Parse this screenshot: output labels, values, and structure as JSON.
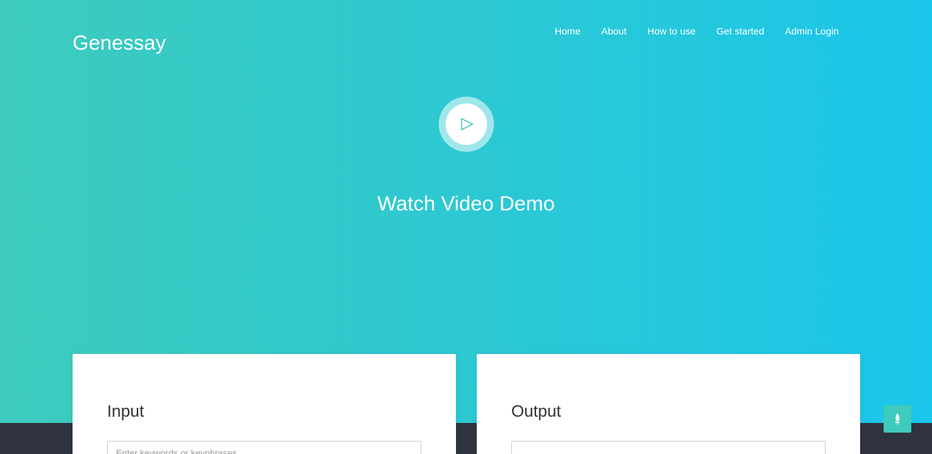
{
  "brand": {
    "name": "Genessay"
  },
  "nav": {
    "items": [
      "Home",
      "About",
      "How to use",
      "Get started",
      "Admin Login"
    ]
  },
  "hero": {
    "play_icon": "play-icon",
    "title": "Watch Video Demo"
  },
  "cards": {
    "input": {
      "title": "Input",
      "placeholder": "Enter keywords or keyphrases",
      "value": ""
    },
    "output": {
      "title": "Output",
      "value": ""
    }
  },
  "back_to_top": {
    "icon": "rocket-icon"
  },
  "colors": {
    "gradient_start": "#3ecbbd",
    "gradient_end": "#1ac6ea",
    "footer": "#2f3340",
    "accent": "#3ecbbd"
  }
}
